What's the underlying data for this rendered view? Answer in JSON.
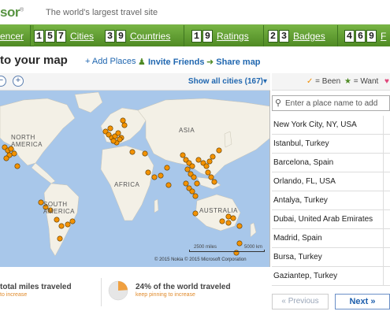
{
  "brand": {
    "logo_text": "sor",
    "logo_mark": "®",
    "tagline": "The world's largest travel site"
  },
  "statsbar": {
    "first_label": "encer",
    "cities": {
      "digits": [
        "1",
        "5",
        "7"
      ],
      "label": "Cities"
    },
    "countries": {
      "digits": [
        "3",
        "9"
      ],
      "label": "Countries"
    },
    "ratings": {
      "digits": [
        "1",
        "9"
      ],
      "label": "Ratings"
    },
    "badges": {
      "digits": [
        "2",
        "3"
      ],
      "label": "Badges"
    },
    "last": {
      "digits": [
        "4",
        "6",
        "9"
      ],
      "label": "F"
    }
  },
  "header": {
    "title": "to your map",
    "add_places": "+ Add Places",
    "invite_friends": "Invite Friends",
    "share_map": "Share map"
  },
  "map_controls": {
    "zoom_out": "−",
    "zoom_in": "+",
    "show_all": "Show all cities  (167)",
    "show_all_arrow": "▾"
  },
  "legend": {
    "been": "= Been",
    "want": "= Want"
  },
  "map": {
    "labels": {
      "north_america": "NORTH\nAMERICA",
      "asia": "ASIA",
      "africa": "AFRICA",
      "south_america": "SOUTH\nAMERICA",
      "australia": "AUSTRALIA"
    },
    "scale_miles": "2500 miles",
    "scale_km": "5000 km",
    "copyright": "© 2015 Nokia   © 2015 Microsoft Corporation"
  },
  "search": {
    "placeholder": "Enter a place name to add"
  },
  "places": [
    "New York City, NY, USA",
    "Istanbul, Turkey",
    "Barcelona, Spain",
    "Orlando, FL, USA",
    "Antalya, Turkey",
    "Dubai, United Arab Emirates",
    "Madrid, Spain",
    "Bursa, Turkey",
    "Gaziantep, Turkey"
  ],
  "pager": {
    "previous": "« Previous",
    "next": "Next »"
  },
  "stats": {
    "miles_label": "total miles traveled",
    "miles_hint": "to increase",
    "world_label": "24% of the world traveled",
    "world_hint": "keep pinning to increase",
    "world_fraction": 0.24
  },
  "colors": {
    "pin": "#f39200",
    "green_bar": "#5f9c2f",
    "link": "#2067b0",
    "ocean": "#a8c7ea",
    "land": "#f3f0e6"
  }
}
